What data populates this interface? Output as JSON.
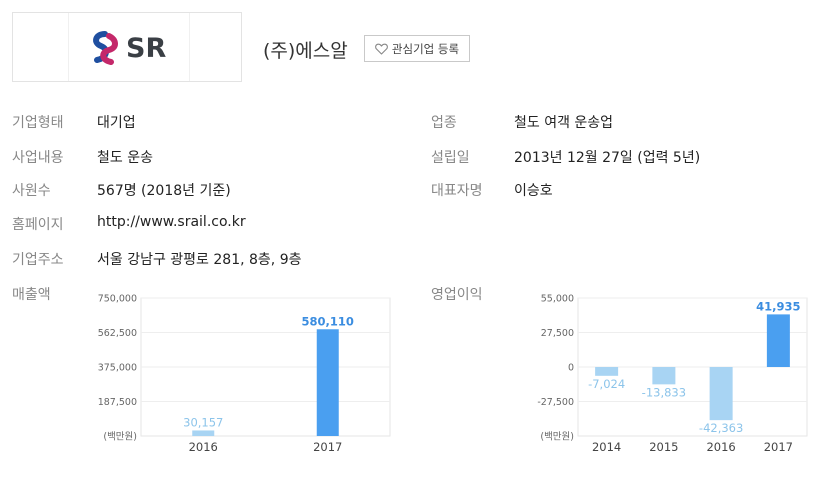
{
  "logo": {
    "text": "SR"
  },
  "company": {
    "name": "(주)에스알"
  },
  "favorite_button": {
    "label": "관심기업 등록"
  },
  "info": {
    "left": [
      {
        "label": "기업형태",
        "value": "대기업"
      },
      {
        "label": "사업내용",
        "value": "철도 운송"
      },
      {
        "label": "사원수",
        "value": "567명 (2018년 기준)"
      },
      {
        "label": "홈페이지",
        "value": "http://www.srail.co.kr"
      },
      {
        "label": "기업주소",
        "value": "서울 강남구 광평로 281, 8층, 9층"
      }
    ],
    "right": [
      {
        "label": "업종",
        "value": "철도 여객 운송업"
      },
      {
        "label": "설립일",
        "value": "2013년 12월 27일 (업력 5년)"
      },
      {
        "label": "대표자명",
        "value": "이승호"
      }
    ]
  },
  "chart_data": [
    {
      "type": "bar",
      "title": "매출액",
      "unit": "(백만원)",
      "categories": [
        "2016",
        "2017"
      ],
      "values": [
        30157,
        580110
      ],
      "value_labels": [
        "30,157",
        "580,110"
      ],
      "ylim": [
        0,
        750000
      ],
      "yticks": [
        "750,000",
        "562,500",
        "375,000",
        "187,500"
      ],
      "ytick_values": [
        750000,
        562500,
        375000,
        187500
      ],
      "colors": {
        "past": "#a8d4f3",
        "latest": "#4a9ff0",
        "past_label": "#8cc4ea",
        "latest_label": "#3b8de0"
      }
    },
    {
      "type": "bar",
      "title": "영업이익",
      "unit": "(백만원)",
      "categories": [
        "2014",
        "2015",
        "2016",
        "2017"
      ],
      "values": [
        -7024,
        -13833,
        -42363,
        41935
      ],
      "value_labels": [
        "-7,024",
        "-13,833",
        "-42,363",
        "41,935"
      ],
      "ylim": [
        -55000,
        55000
      ],
      "yticks": [
        "55,000",
        "27,500",
        "0",
        "-27,500"
      ],
      "ytick_values": [
        55000,
        27500,
        0,
        -27500
      ],
      "colors": {
        "past": "#a8d4f3",
        "latest": "#4a9ff0",
        "past_label": "#8cc4ea",
        "latest_label": "#3b8de0"
      }
    }
  ]
}
